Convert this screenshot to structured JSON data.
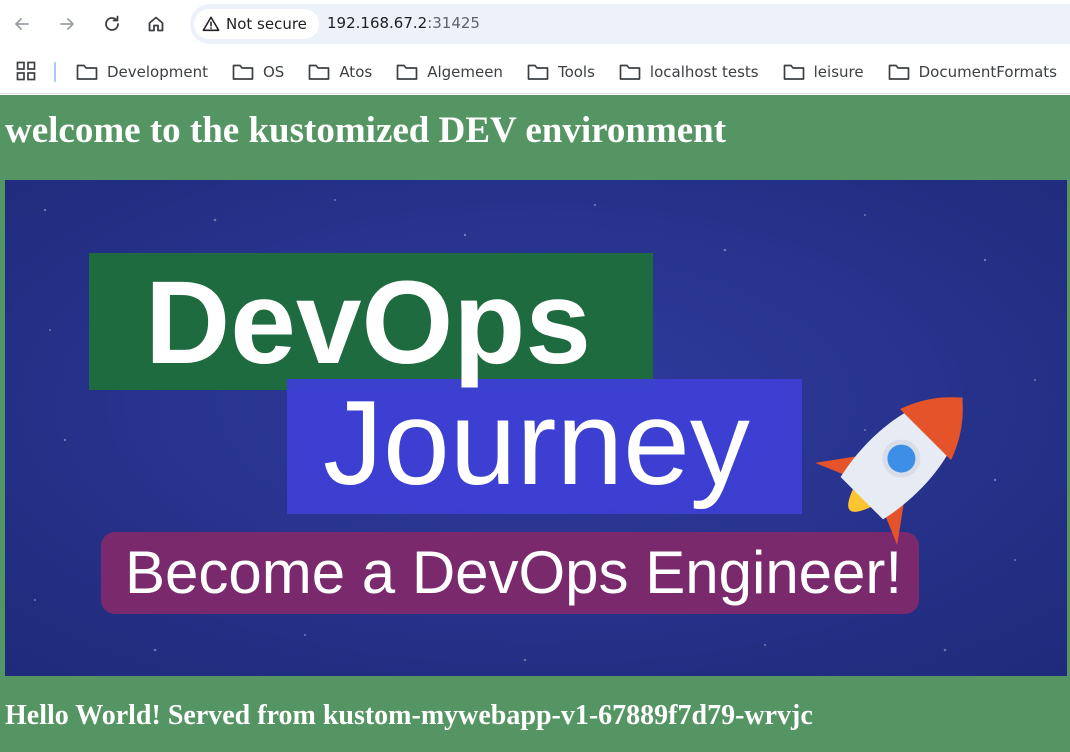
{
  "browser": {
    "security_label": "Not secure",
    "url_host": "192.168.67.2",
    "url_port": ":31425",
    "icons": {
      "back": "back-arrow-icon",
      "forward": "forward-arrow-icon",
      "reload": "reload-icon",
      "home": "home-icon",
      "warning": "warning-triangle-icon"
    }
  },
  "bookmarks": {
    "items": [
      {
        "label": "Development"
      },
      {
        "label": "OS"
      },
      {
        "label": "Atos"
      },
      {
        "label": "Algemeen"
      },
      {
        "label": "Tools"
      },
      {
        "label": "localhost tests"
      },
      {
        "label": "leisure"
      },
      {
        "label": "DocumentFormats"
      },
      {
        "label": ""
      }
    ]
  },
  "page": {
    "heading": "welcome to the kustomized DEV environment",
    "footer": "Hello World! Served from kustom-mywebapp-v1-67889f7d79-wrvjc",
    "background_color": "#559563",
    "banner": {
      "line1": "DevOps",
      "line2": "Journey",
      "line3": "Become a DevOps Engineer!",
      "colors": {
        "background": "#283593",
        "box1": "#1e6b3f",
        "box2": "#3d3fd4",
        "box3": "#7a2a6c"
      }
    }
  }
}
